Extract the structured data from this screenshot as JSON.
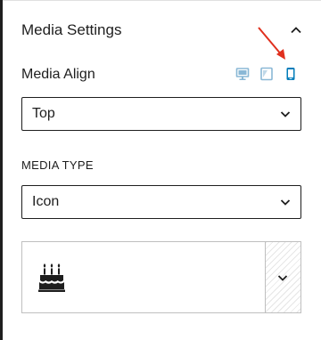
{
  "panel": {
    "title": "Media Settings",
    "collapse_icon": "chevron-up-icon"
  },
  "media_align": {
    "label": "Media Align",
    "devices": [
      {
        "name": "desktop",
        "icon": "desktop-icon",
        "active": false
      },
      {
        "name": "tablet",
        "icon": "tablet-icon",
        "active": false
      },
      {
        "name": "mobile",
        "icon": "mobile-icon",
        "active": true
      }
    ],
    "selected": "Top"
  },
  "media_type": {
    "label": "MEDIA TYPE",
    "selected": "Icon"
  },
  "icon_picker": {
    "selected_icon": "birthday-cake-icon",
    "toggle_icon": "chevron-down-icon"
  },
  "colors": {
    "accent": "#007cba",
    "device_inactive": "#8ab8d6",
    "annotation_arrow": "#e0301e",
    "text": "#1e1e1e"
  }
}
